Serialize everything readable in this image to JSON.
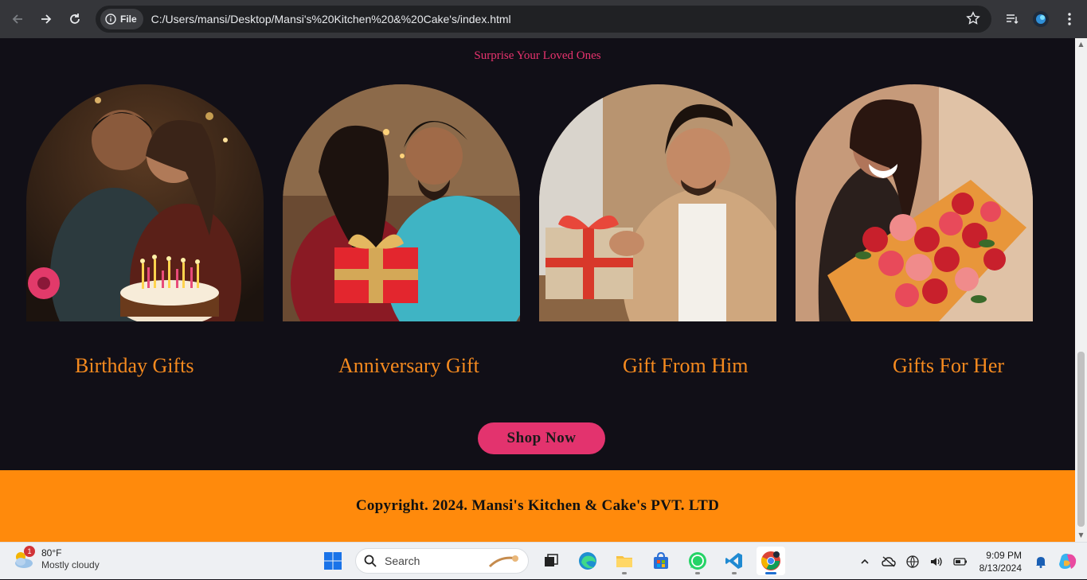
{
  "browser": {
    "file_chip": "File",
    "url": "C:/Users/mansi/Desktop/Mansi's%20Kitchen%20&%20Cake's/index.html"
  },
  "page": {
    "tagline": "Surprise Your Loved Ones",
    "cards": [
      {
        "title": "Birthday Gifts"
      },
      {
        "title": "Anniversary Gift"
      },
      {
        "title": "Gift From Him"
      },
      {
        "title": "Gifts For Her"
      }
    ],
    "shop_button": "Shop Now",
    "footer": "Copyright. 2024. Mansi's Kitchen & Cake's PVT. LTD",
    "colors": {
      "background": "#110f17",
      "accent_pink": "#e3336e",
      "accent_orange": "#f58a1f",
      "footer_orange": "#ff8a0c"
    }
  },
  "taskbar": {
    "weather_badge": "1",
    "weather_temp": "80°F",
    "weather_condition": "Mostly cloudy",
    "search_placeholder": "Search",
    "time": "9:09 PM",
    "date": "8/13/2024",
    "apps": [
      "windows-start",
      "search",
      "task-view",
      "edge",
      "file-explorer",
      "microsoft-store",
      "whatsapp",
      "vs-code",
      "chrome"
    ]
  }
}
